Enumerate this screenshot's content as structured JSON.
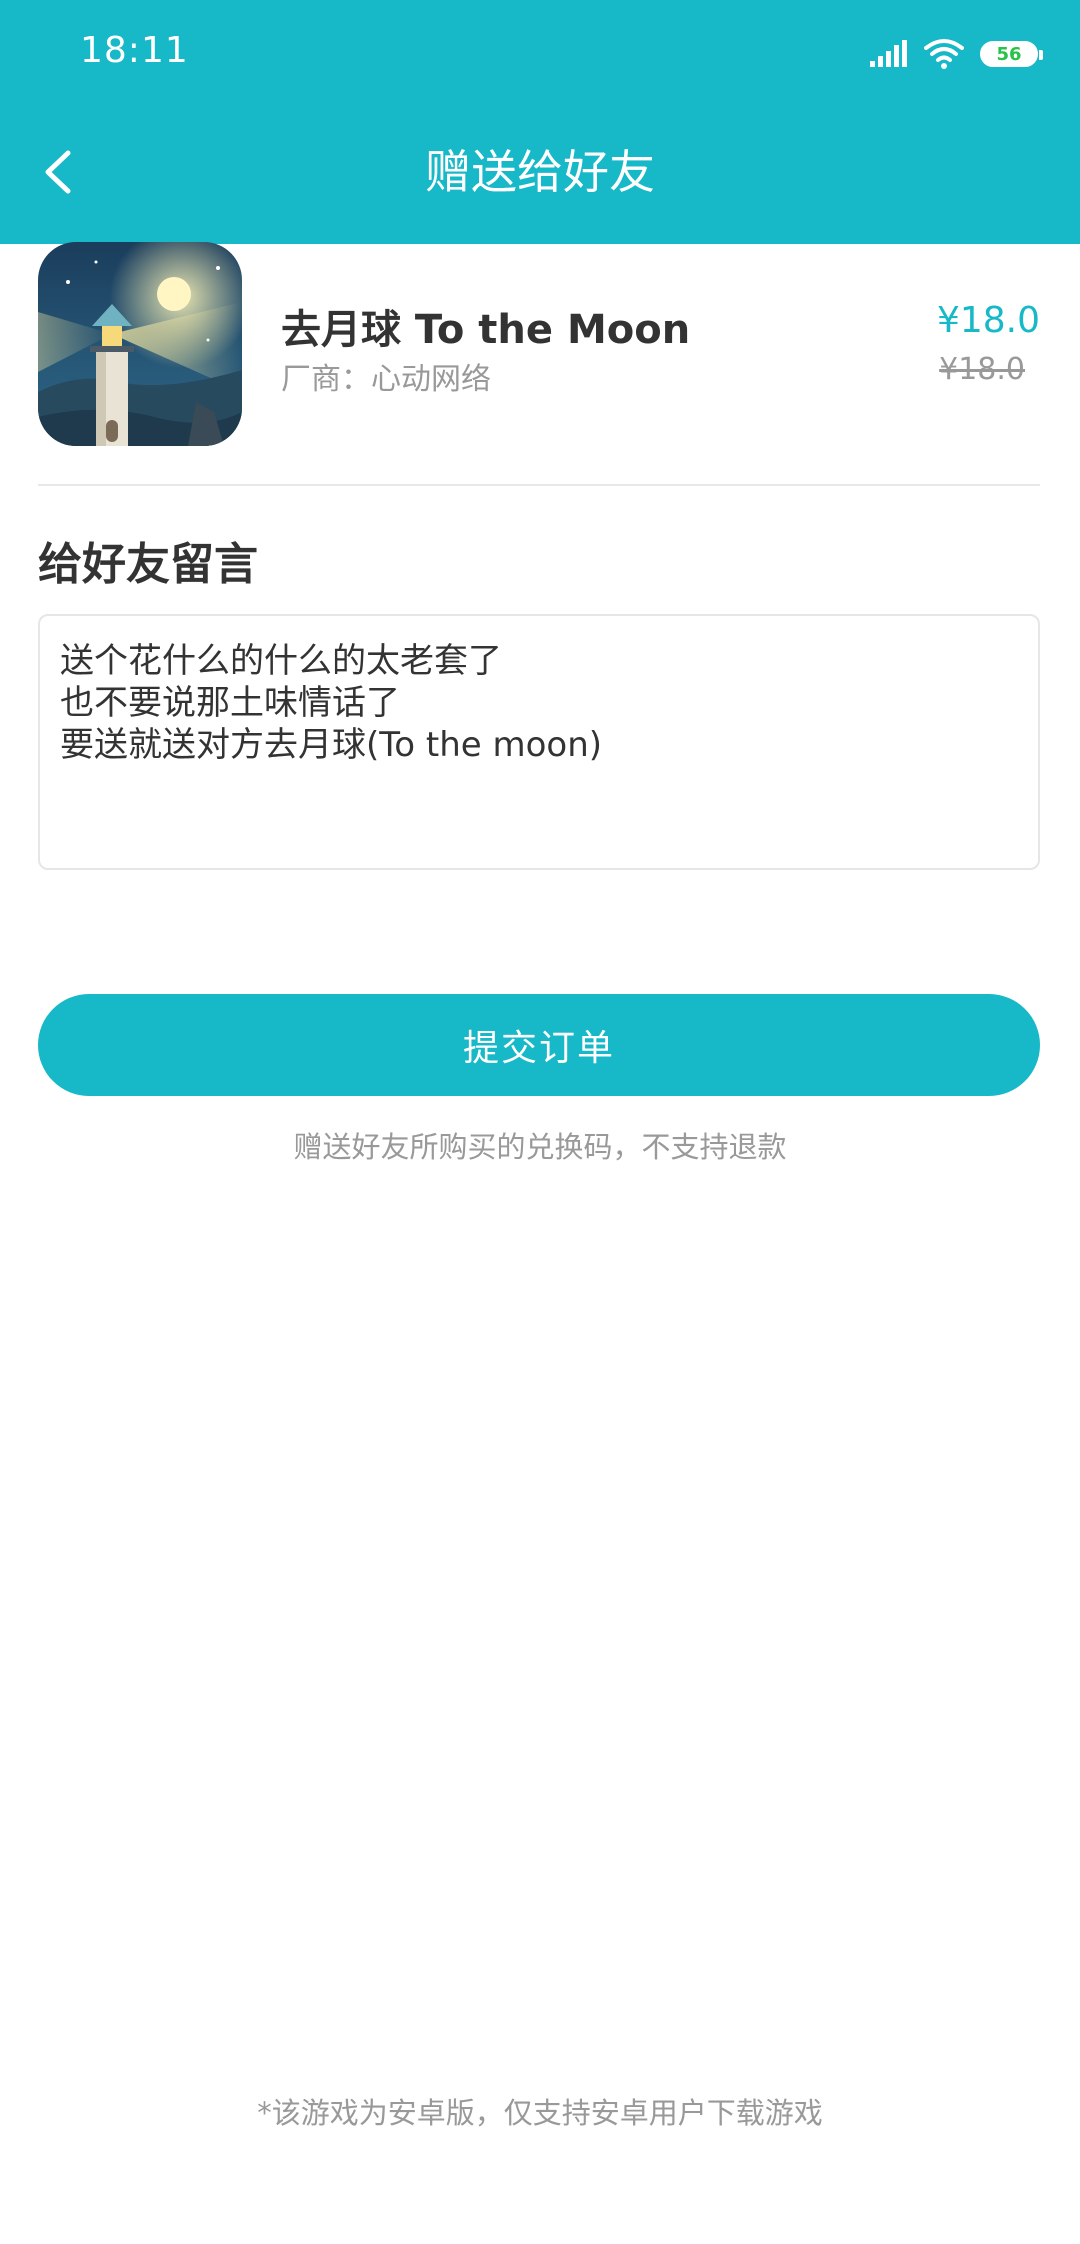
{
  "status_bar": {
    "time": "18:11",
    "battery_level": "56"
  },
  "header": {
    "title": "赠送给好友",
    "back_icon": "chevron-left-icon"
  },
  "product": {
    "icon": "game-lighthouse-icon",
    "title": "去月球 To the Moon",
    "vendor": "厂商：心动网络",
    "price": "¥18.0",
    "original_price": "¥18.0"
  },
  "message": {
    "section_title": "给好友留言",
    "text": "送个花什么的什么的太老套了\n也不要说那土味情话了\n要送就送对方去月球(To the moon)"
  },
  "actions": {
    "submit_label": "提交订单"
  },
  "notices": {
    "refund_notice": "赠送好友所购买的兑换码，不支持退款",
    "platform_notice": "*该游戏为安卓版，仅支持安卓用户下载游戏"
  },
  "colors": {
    "accent": "#17b8c8",
    "text_primary": "#333333",
    "text_secondary": "#999999"
  }
}
